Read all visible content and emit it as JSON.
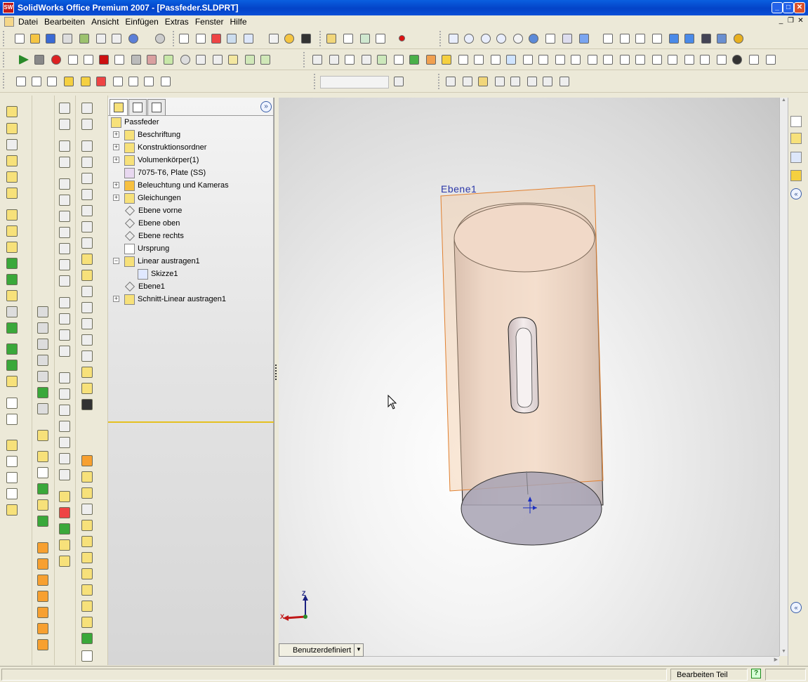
{
  "window": {
    "title": "SolidWorks Office Premium 2007 - [Passfeder.SLDPRT]",
    "app_icon": "solidworks-icon"
  },
  "menu": [
    "Datei",
    "Bearbeiten",
    "Ansicht",
    "Einfügen",
    "Extras",
    "Fenster",
    "Hilfe"
  ],
  "feature_manager": {
    "root": "Passfeder",
    "items": [
      {
        "label": "Beschriftung",
        "icon": "annotation-icon",
        "expander": "+",
        "level": 1
      },
      {
        "label": "Konstruktionsordner",
        "icon": "design-binder-icon",
        "expander": "+",
        "level": 1
      },
      {
        "label": "Volumenkörper(1)",
        "icon": "solid-bodies-icon",
        "expander": "+",
        "level": 1
      },
      {
        "label": "7075-T6, Plate (SS)",
        "icon": "material-icon",
        "expander": "",
        "level": 1
      },
      {
        "label": "Beleuchtung und Kameras",
        "icon": "lights-cameras-icon",
        "expander": "+",
        "level": 1
      },
      {
        "label": "Gleichungen",
        "icon": "equations-icon",
        "expander": "+",
        "level": 1
      },
      {
        "label": "Ebene vorne",
        "icon": "plane-icon",
        "expander": "",
        "level": 1
      },
      {
        "label": "Ebene oben",
        "icon": "plane-icon",
        "expander": "",
        "level": 1
      },
      {
        "label": "Ebene rechts",
        "icon": "plane-icon",
        "expander": "",
        "level": 1
      },
      {
        "label": "Ursprung",
        "icon": "origin-icon",
        "expander": "",
        "level": 1
      },
      {
        "label": "Linear austragen1",
        "icon": "extrude-icon",
        "expander": "−",
        "level": 1
      },
      {
        "label": "Skizze1",
        "icon": "sketch-icon",
        "expander": "",
        "level": 2
      },
      {
        "label": "Ebene1",
        "icon": "plane-icon",
        "expander": "",
        "level": 1
      },
      {
        "label": "Schnitt-Linear austragen1",
        "icon": "cut-extrude-icon",
        "expander": "+",
        "level": 1
      }
    ]
  },
  "graphics": {
    "plane_label": "Ebene1",
    "triad": {
      "z": "Z",
      "x": "X"
    }
  },
  "view_orientation": "Benutzerdefiniert",
  "status": {
    "mode": "Bearbeiten Teil",
    "help_label": "?"
  },
  "colors": {
    "titlebar": "#0a5fe0",
    "plane_outline": "#e08030",
    "plane_fill": "#f3c8a0",
    "selection_line": "#e4c020"
  }
}
